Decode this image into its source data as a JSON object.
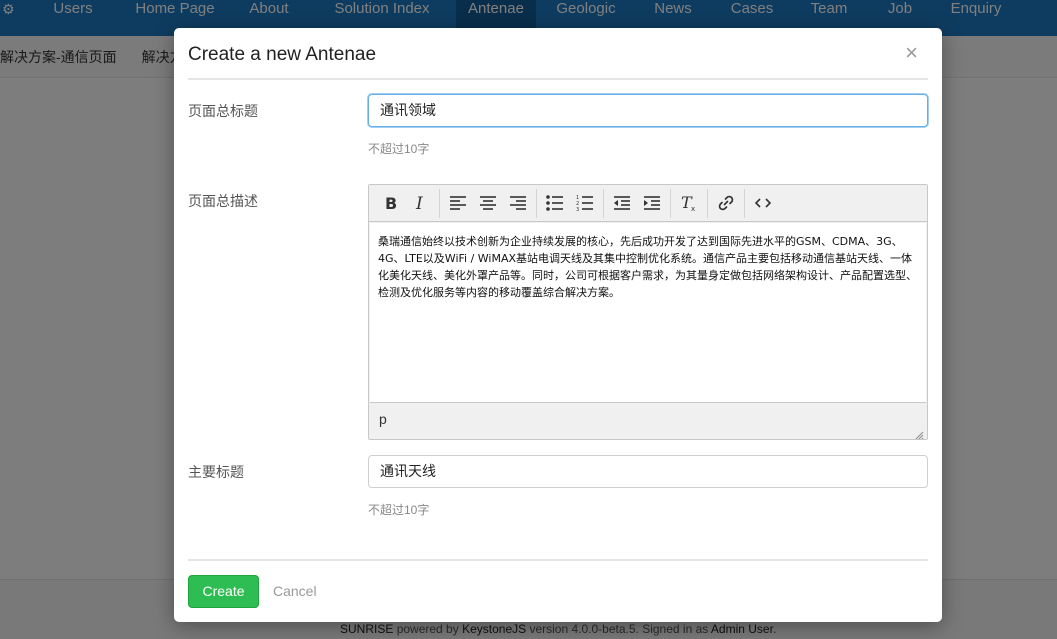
{
  "topnav": {
    "items": [
      {
        "label": "Users",
        "width": 94,
        "active": false
      },
      {
        "label": "Home Page",
        "width": 110,
        "active": false
      },
      {
        "label": "About",
        "width": 78,
        "active": false
      },
      {
        "label": "Solution Index",
        "width": 148,
        "active": false
      },
      {
        "label": "Antenae",
        "width": 80,
        "active": true
      },
      {
        "label": "Geologic",
        "width": 100,
        "active": false
      },
      {
        "label": "News",
        "width": 74,
        "active": false
      },
      {
        "label": "Cases",
        "width": 84,
        "active": false
      },
      {
        "label": "Team",
        "width": 70,
        "active": false
      },
      {
        "label": "Job",
        "width": 72,
        "active": false
      },
      {
        "label": "Enquiry",
        "width": 80,
        "active": false
      }
    ]
  },
  "subnav": {
    "items": [
      "解决方案-通信页面",
      "解决方"
    ]
  },
  "footer": {
    "brand": "SUNRISE",
    "powered_by": "powered by",
    "engine": "KeystoneJS",
    "version_text": "version 4.0.0-beta.5. Signed in as",
    "user": "Admin User",
    "end": "."
  },
  "modal": {
    "title": "Create a new Antenae",
    "close_symbol": "×",
    "fields": {
      "page_title": {
        "label": "页面总标题",
        "value": "通讯领域",
        "hint": "不超过10字"
      },
      "page_description": {
        "label": "页面总描述",
        "content": "桑瑞通信始终以技术创新为企业持续发展的核心，先后成功开发了达到国际先进水平的GSM、CDMA、3G、4G、LTE以及WiFi / WiMAX基站电调天线及其集中控制优化系统。通信产品主要包括移动通信基站天线、一体化美化天线、美化外罩产品等。同时，公司可根据客户需求，为其量身定做包括网络架构设计、产品配置选型、检测及优化服务等内容的移动覆盖综合解决方案。",
        "status_path": "p"
      },
      "main_title": {
        "label": "主要标题",
        "value": "通讯天线",
        "hint": "不超过10字"
      }
    },
    "buttons": {
      "create": "Create",
      "cancel": "Cancel"
    }
  },
  "colors": {
    "nav_bg": "#1c78c0",
    "nav_active": "#135c97",
    "create_green": "#2dbd52",
    "focus_blue": "#66afe9"
  }
}
